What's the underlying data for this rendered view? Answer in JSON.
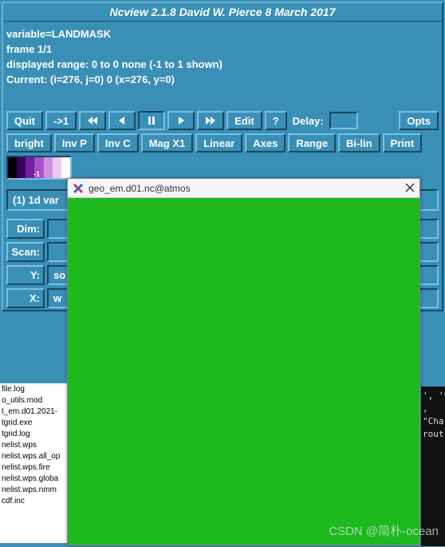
{
  "title": "Ncview 2.1.8 David W. Pierce  8 March 2017",
  "info": {
    "variable": "variable=LANDMASK",
    "frame": "frame 1/1",
    "range": "displayed range: 0 to 0 none (-1 to 1 shown)",
    "current": "Current: (i=276, j=0) 0 (x=276, y=0)"
  },
  "toolbar1": {
    "quit": "Quit",
    "step": "->1",
    "edit": "Edit",
    "help": "?",
    "delay_label": "Delay:",
    "opts": "Opts"
  },
  "toolbar2": {
    "bright": "bright",
    "invp": "Inv P",
    "invc": "Inv C",
    "mag": "Mag X1",
    "linear": "Linear",
    "axes": "Axes",
    "range": "Range",
    "bilin": "Bi-lin",
    "print": "Print"
  },
  "colorbar": {
    "label_neg1": "-1"
  },
  "vars": {
    "header": "(1) 1d var"
  },
  "dim": {
    "dim_label": "Dim:",
    "scan_label": "Scan:",
    "y_label": "Y:",
    "y_value": "so",
    "x_label": "X:",
    "x_value": "w"
  },
  "file_list": [
    "file.log",
    "o_utils.mod",
    "t_em.d01.2021-",
    "tgrid.exe",
    "tgrid.log",
    "nelist.wps",
    "nelist.wps.all_op",
    "nelist.wps.fire",
    "nelist.wps.globa",
    "nelist.wps.nmm",
    "cdf.inc"
  ],
  "terminal_lines": [
    "', 'v",
    ",",
    "",
    "\"Cha",
    "",
    "rout",
    ""
  ],
  "popup": {
    "title": "geo_em.d01.nc@atmos"
  },
  "watermark": "CSDN @简朴-ocean",
  "chart_data": {
    "type": "colorbar",
    "range": [
      -1,
      1
    ],
    "ticks": [
      -1
    ],
    "gradient": [
      "#000000",
      "#4b0082",
      "#a040c0",
      "#d080d8",
      "#f0c0f0",
      "#ffffff"
    ]
  }
}
